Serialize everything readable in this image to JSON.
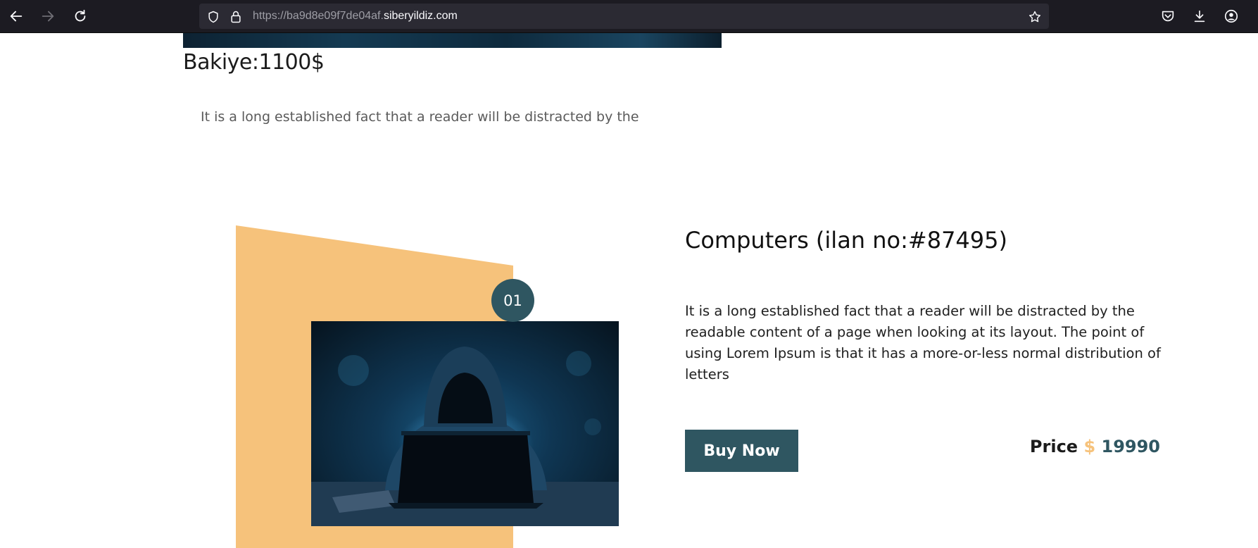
{
  "browser": {
    "url_prefix": "https://ba9d8e09f7de04af.",
    "url_host": "siberyildiz.com"
  },
  "account": {
    "balance": "Bakiye:1100$"
  },
  "intro_text": "It is a long established fact that a reader will be distracted by the",
  "listing": {
    "badge": "01",
    "title": "Computers (ilan no:#87495)",
    "description": "It is a long established fact that a reader will be distracted by the readable content of a page when looking at its layout. The point of using Lorem Ipsum is that it has a more-or-less normal distribution of letters",
    "buy_label": "Buy Now",
    "price_label": "Price",
    "currency": "$",
    "price_value": "19990"
  },
  "colors": {
    "accent_teal": "#2f5661",
    "accent_orange": "#f6c27b",
    "chrome_bg": "#1c1b22"
  }
}
